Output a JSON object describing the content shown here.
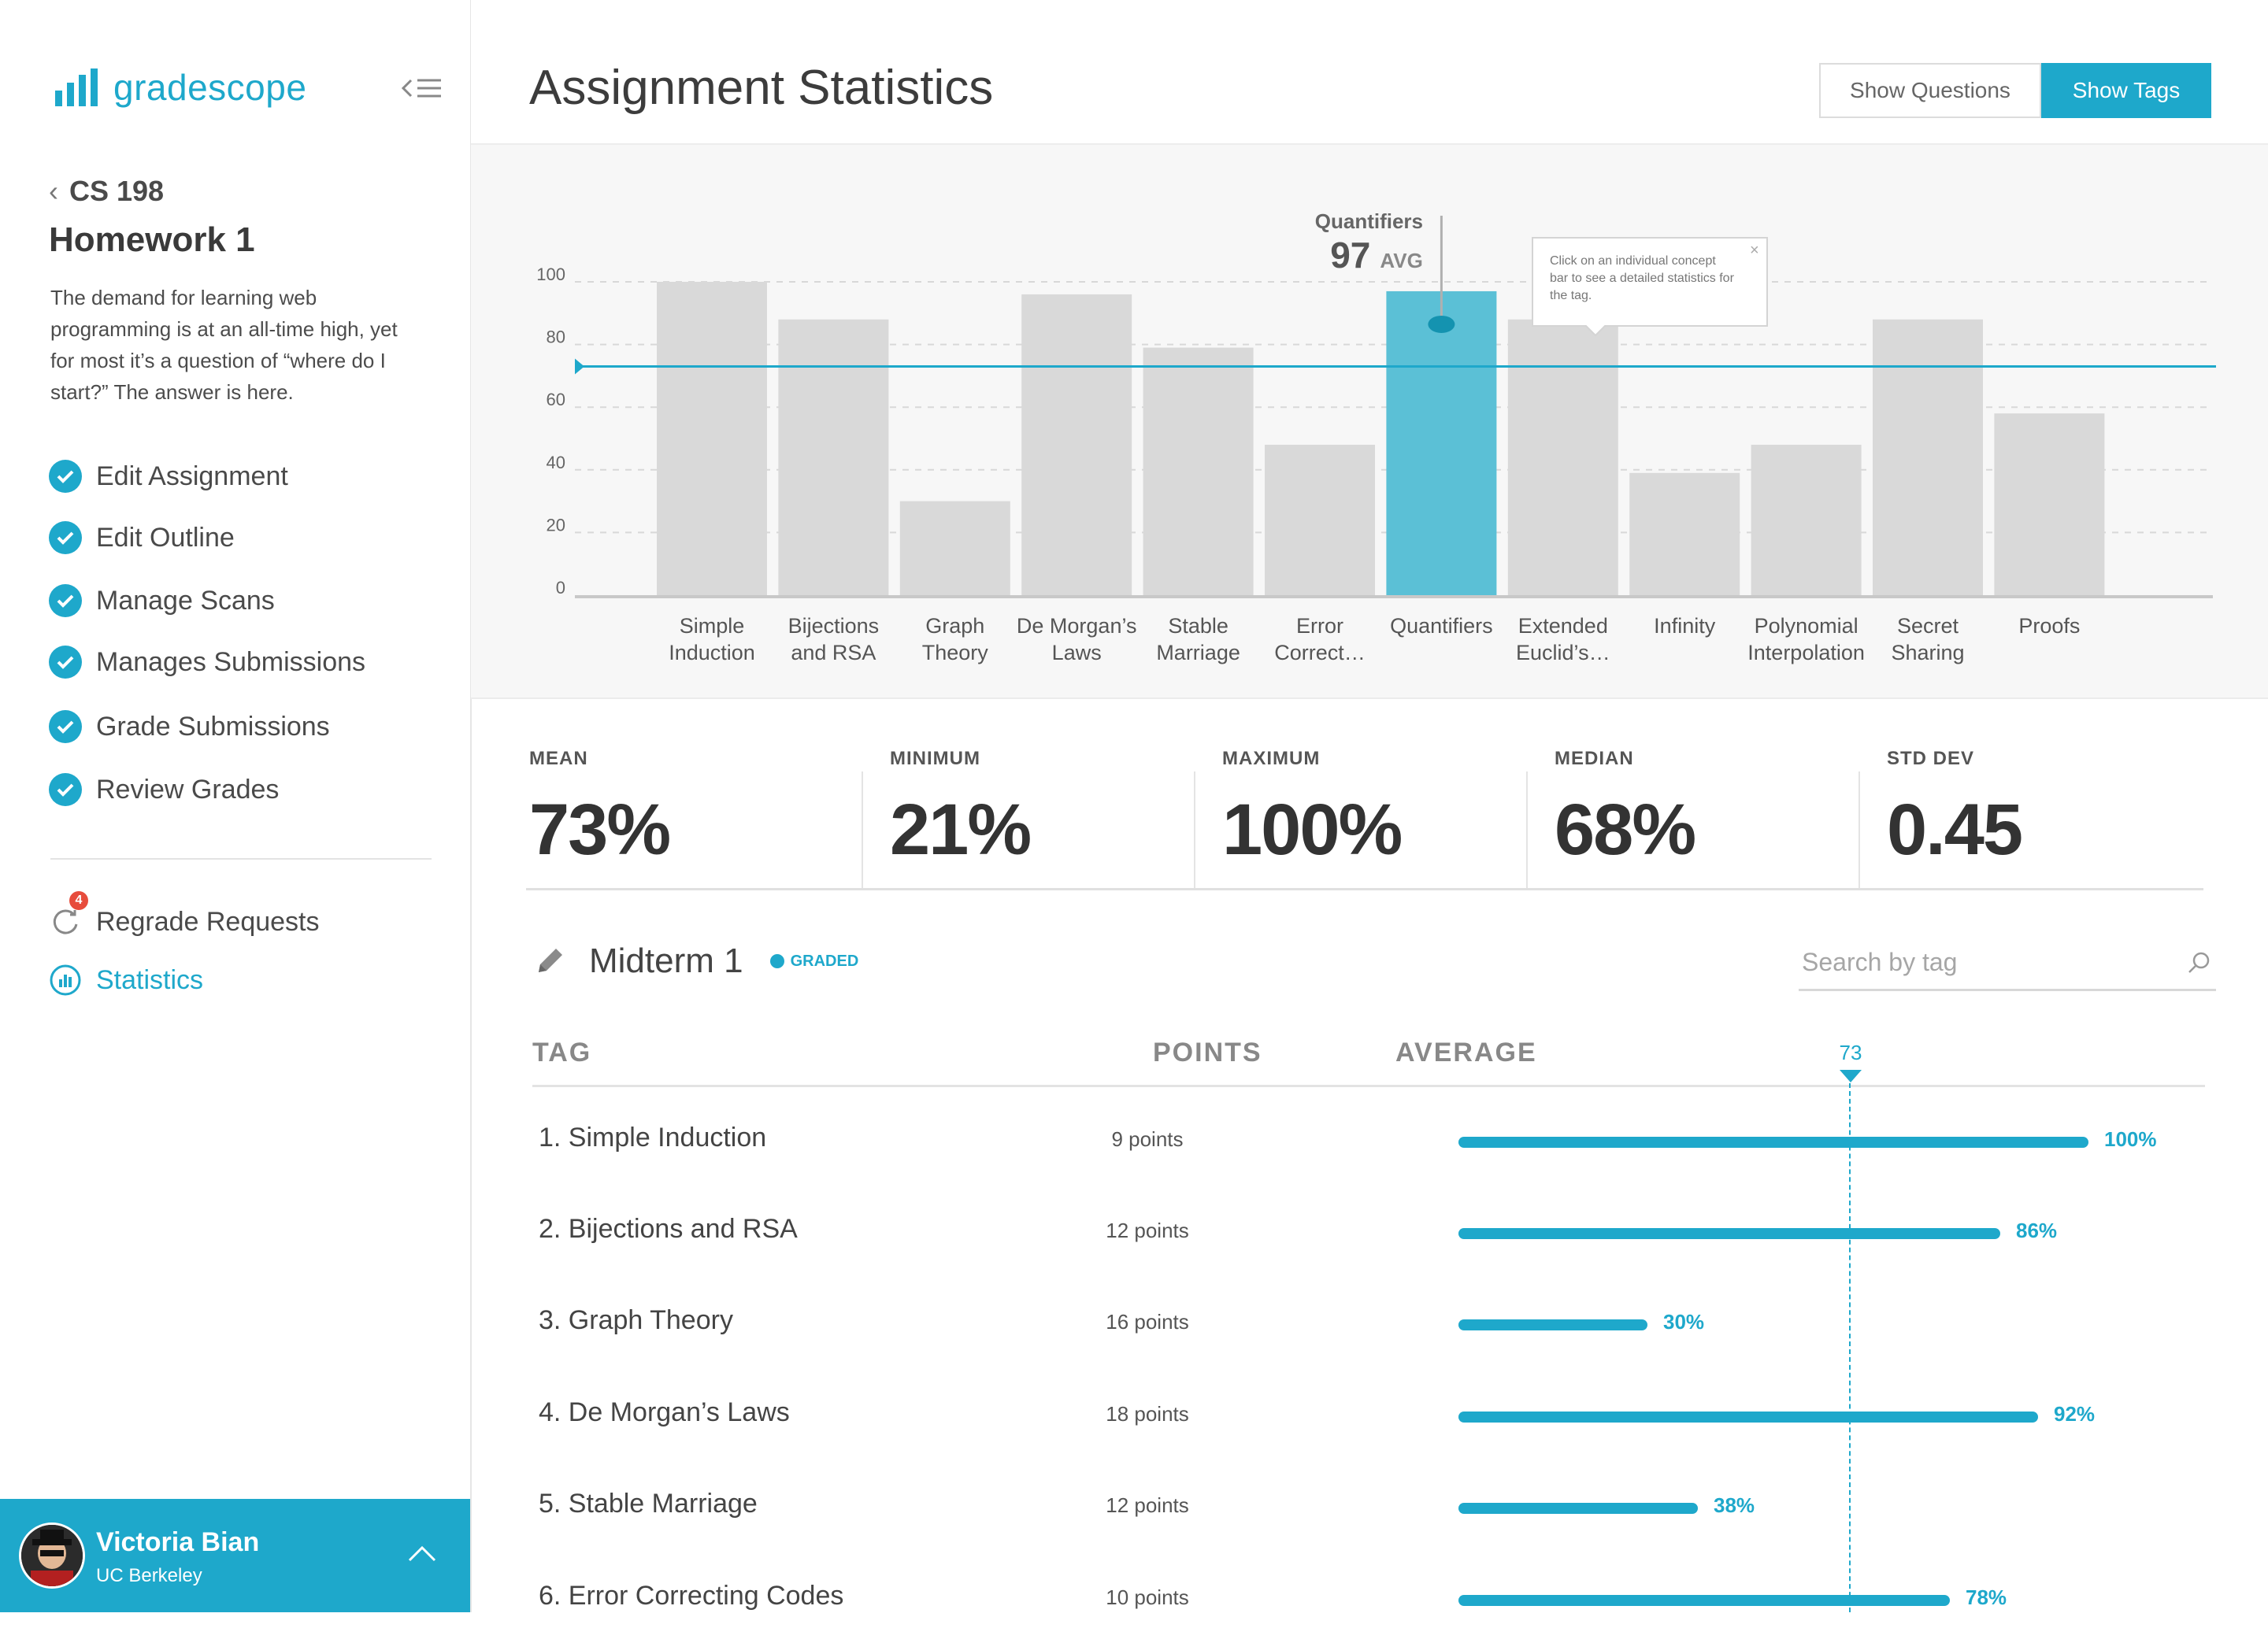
{
  "app": {
    "name": "gradescope"
  },
  "sidebar": {
    "course": "CS 198",
    "assignment": "Homework 1",
    "description_lines": [
      "The demand for learning web",
      "programming is at an all-time high, yet",
      "for most it’s a question of “where do I",
      "start?” The answer is here."
    ],
    "steps": [
      "Edit Assignment",
      "Edit Outline",
      "Manage Scans",
      "Manages Submissions",
      "Grade Submissions",
      "Review Grades"
    ],
    "regrade": {
      "label": "Regrade Requests",
      "count": "4"
    },
    "statistics": {
      "label": "Statistics"
    },
    "user": {
      "name": "Victoria Bian",
      "org": "UC Berkeley"
    }
  },
  "header": {
    "title": "Assignment Statistics",
    "show_questions": "Show Questions",
    "show_tags": "Show Tags"
  },
  "chart_data": {
    "type": "bar",
    "categories": [
      [
        "Simple",
        "Induction"
      ],
      [
        "Bijections",
        "and RSA"
      ],
      [
        "Graph",
        "Theory"
      ],
      [
        "De Morgan’s",
        "Laws"
      ],
      [
        "Stable",
        "Marriage"
      ],
      [
        "Error",
        "Correct…"
      ],
      [
        "Quantifiers",
        ""
      ],
      [
        "Extended",
        "Euclid’s…"
      ],
      [
        "Infinity",
        ""
      ],
      [
        "Polynomial",
        "Interpolation"
      ],
      [
        "Secret",
        "Sharing"
      ],
      [
        "Proofs",
        ""
      ]
    ],
    "values": [
      100,
      88,
      30,
      96,
      79,
      48,
      97,
      88,
      39,
      48,
      88,
      58
    ],
    "ylim": [
      0,
      100
    ],
    "yticks": [
      0,
      20,
      40,
      60,
      80,
      100
    ],
    "average": 73,
    "highlight_index": 6,
    "callout": {
      "label": "Quantifiers",
      "value": "97",
      "suffix": "AVG"
    },
    "tooltip": [
      "Click on an individual concept",
      "bar to see a detailed statistics for",
      "the tag."
    ],
    "colors": {
      "bar": "#d9d9d9",
      "highlight": "#5bc0d6",
      "accent": "#1ea8cb"
    }
  },
  "stats": [
    {
      "label": "MEAN",
      "value": "73%"
    },
    {
      "label": "MINIMUM",
      "value": "21%"
    },
    {
      "label": "MAXIMUM",
      "value": "100%"
    },
    {
      "label": "MEDIAN",
      "value": "68%"
    },
    {
      "label": "STD DEV",
      "value": "0.45"
    }
  ],
  "section": {
    "title": "Midterm 1",
    "status": "GRADED",
    "search_placeholder": "Search by tag"
  },
  "table": {
    "headers": {
      "tag": "TAG",
      "points": "POINTS",
      "average": "AVERAGE"
    },
    "avg_marker": "73",
    "avg_value": 73,
    "rows": [
      {
        "tag": "1. Simple Induction",
        "points": "9 points",
        "pct": "100%",
        "value": 100
      },
      {
        "tag": "2. Bijections and RSA",
        "points": "12 points",
        "pct": "86%",
        "value": 86
      },
      {
        "tag": "3. Graph Theory",
        "points": "16 points",
        "pct": "30%",
        "value": 30
      },
      {
        "tag": "4. De Morgan’s Laws",
        "points": "18 points",
        "pct": "92%",
        "value": 92
      },
      {
        "tag": "5. Stable Marriage",
        "points": "12 points",
        "pct": "38%",
        "value": 38
      },
      {
        "tag": "6. Error Correcting Codes",
        "points": "10 points",
        "pct": "78%",
        "value": 78
      }
    ]
  }
}
